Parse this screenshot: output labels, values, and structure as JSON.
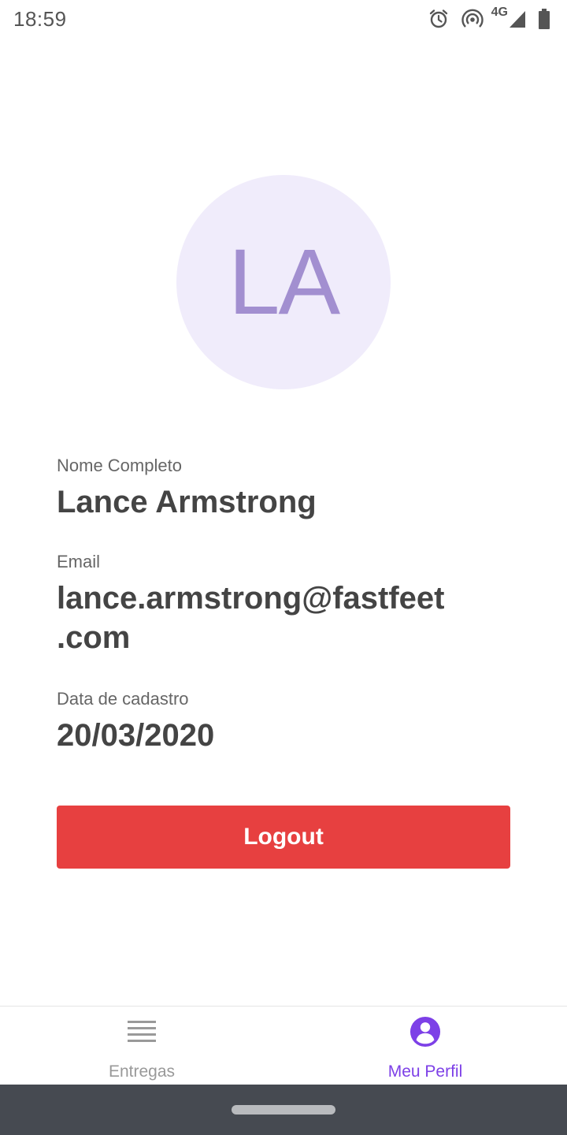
{
  "status_bar": {
    "time": "18:59",
    "network_type": "4G",
    "icons": [
      "alarm-icon",
      "hotspot-icon",
      "signal-icon",
      "battery-icon"
    ]
  },
  "profile": {
    "initials": "LA",
    "avatar_bg_color": "#F0ECFB",
    "avatar_text_color": "#A28FD0",
    "fields": [
      {
        "label": "Nome Completo",
        "value": "Lance Armstrong"
      },
      {
        "label": "Email",
        "value": "lance.armstrong@fastfeet\n.com"
      },
      {
        "label": "Data de cadastro",
        "value": "20/03/2020"
      }
    ]
  },
  "logout": {
    "label": "Logout",
    "color": "#E74040"
  },
  "tab_bar": {
    "tabs": [
      {
        "label": "Entregas",
        "icon": "list-icon",
        "active": false,
        "color": "#999999"
      },
      {
        "label": "Meu Perfil",
        "icon": "profile-icon",
        "active": true,
        "color": "#7D40E7"
      }
    ]
  }
}
